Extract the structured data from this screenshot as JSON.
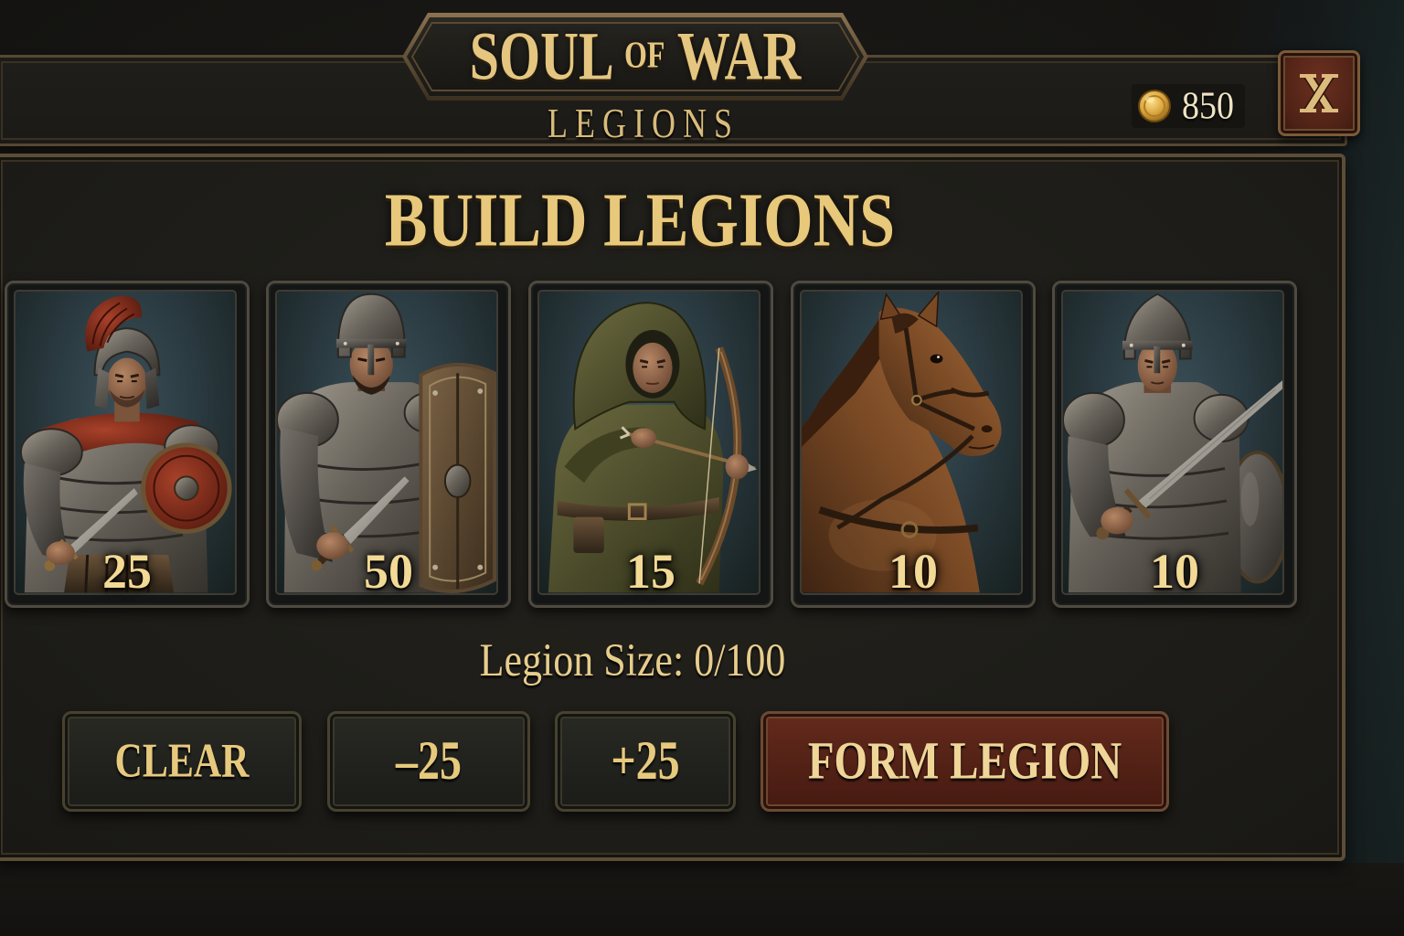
{
  "header": {
    "title_word1": "SOUL",
    "title_small": "OF",
    "title_word2": "WAR",
    "subtitle": "LEGIONS"
  },
  "currency": {
    "icon": "gold-coin-icon",
    "amount": "850"
  },
  "close_button": {
    "icon": "close-icon"
  },
  "panel": {
    "heading": "BUILD LEGIONS"
  },
  "units": [
    {
      "portrait": "legionary-portrait-icon",
      "count": "25"
    },
    {
      "portrait": "knight-portrait-icon",
      "count": "50"
    },
    {
      "portrait": "archer-portrait-icon",
      "count": "15"
    },
    {
      "portrait": "horse-portrait-icon",
      "count": "10"
    },
    {
      "portrait": "swordsman-portrait-icon",
      "count": "10"
    }
  ],
  "legion_size": {
    "label": "Legion Size:",
    "value": "0/100"
  },
  "buttons": {
    "clear": "CLEAR",
    "minus": "–25",
    "plus": "+25",
    "form": "FORM LEGION"
  },
  "colors": {
    "accent_gold": "#e7c97e",
    "panel_bg": "#1f1e1a",
    "card_bg": "#2f4047",
    "form_button_bg": "#5a2318",
    "close_button_bg": "#5c2a1c"
  }
}
